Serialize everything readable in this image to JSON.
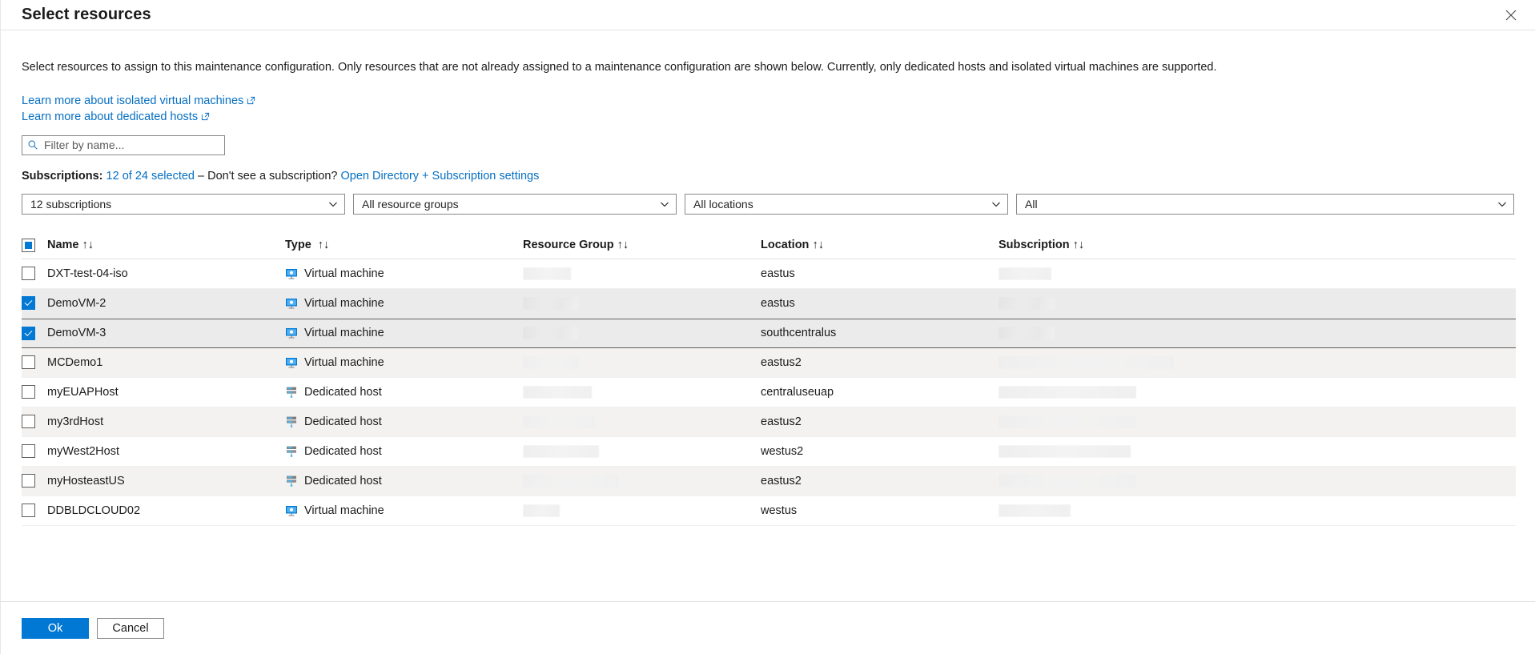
{
  "blade": {
    "title": "Select resources",
    "close_icon": "close-icon",
    "description": "Select resources to assign to this maintenance configuration. Only resources that are not already assigned to a maintenance configuration are shown below. Currently, only dedicated hosts and isolated virtual machines are supported."
  },
  "links": [
    {
      "label": "Learn more about isolated virtual machines",
      "icon": "external-link-icon"
    },
    {
      "label": "Learn more about dedicated hosts",
      "icon": "external-link-icon"
    }
  ],
  "filter": {
    "placeholder": "Filter by name...",
    "value": "",
    "icon": "search-icon"
  },
  "subscriptions_line": {
    "label": "Subscriptions:",
    "selected_link": "12 of 24 selected",
    "separator": "– Don't see a subscription?",
    "settings_link": "Open Directory + Subscription settings"
  },
  "dropdowns": [
    {
      "name": "subscription-filter",
      "value": "12 subscriptions"
    },
    {
      "name": "resource-group-filter",
      "value": "All resource groups"
    },
    {
      "name": "location-filter",
      "value": "All locations"
    },
    {
      "name": "type-filter",
      "value": "All"
    }
  ],
  "table": {
    "header_checkbox_state": "indeterminate",
    "columns": [
      {
        "label": "Name",
        "sort_icon": "sort-arrows-icon"
      },
      {
        "label": "Type",
        "sort_icon": "sort-arrows-icon"
      },
      {
        "label": "Resource Group",
        "sort_icon": "sort-arrows-icon"
      },
      {
        "label": "Location",
        "sort_icon": "sort-arrows-icon"
      },
      {
        "label": "Subscription",
        "sort_icon": "sort-arrows-icon"
      }
    ],
    "rows": [
      {
        "name": "DXT-test-04-iso",
        "type": "Virtual machine",
        "type_icon": "virtual-machine-icon",
        "location": "eastus",
        "checked": false,
        "selected": false,
        "focused": false,
        "rg_width": 60,
        "sub_width": 66
      },
      {
        "name": "DemoVM-2",
        "type": "Virtual machine",
        "type_icon": "virtual-machine-icon",
        "location": "eastus",
        "checked": true,
        "selected": true,
        "focused": false,
        "rg_width": 68,
        "sub_width": 70
      },
      {
        "name": "DemoVM-3",
        "type": "Virtual machine",
        "type_icon": "virtual-machine-icon",
        "location": "southcentralus",
        "checked": true,
        "selected": true,
        "focused": true,
        "rg_width": 68,
        "sub_width": 70
      },
      {
        "name": "MCDemo1",
        "type": "Virtual machine",
        "type_icon": "virtual-machine-icon",
        "location": "eastus2",
        "checked": false,
        "selected": false,
        "focused": false,
        "rg_width": 70,
        "sub_width": 219
      },
      {
        "name": "myEUAPHost",
        "type": "Dedicated host",
        "type_icon": "dedicated-host-icon",
        "location": "centraluseuap",
        "checked": false,
        "selected": false,
        "focused": false,
        "rg_width": 86,
        "sub_width": 172
      },
      {
        "name": "my3rdHost",
        "type": "Dedicated host",
        "type_icon": "dedicated-host-icon",
        "location": "eastus2",
        "checked": false,
        "selected": false,
        "focused": false,
        "rg_width": 90,
        "sub_width": 172
      },
      {
        "name": "myWest2Host",
        "type": "Dedicated host",
        "type_icon": "dedicated-host-icon",
        "location": "westus2",
        "checked": false,
        "selected": false,
        "focused": false,
        "rg_width": 95,
        "sub_width": 165
      },
      {
        "name": "myHosteastUS",
        "type": "Dedicated host",
        "type_icon": "dedicated-host-icon",
        "location": "eastus2",
        "checked": false,
        "selected": false,
        "focused": false,
        "rg_width": 120,
        "sub_width": 172
      },
      {
        "name": "DDBLDCLOUD02",
        "type": "Virtual machine",
        "type_icon": "virtual-machine-icon",
        "location": "westus",
        "checked": false,
        "selected": false,
        "focused": false,
        "rg_width": 46,
        "sub_width": 90
      }
    ]
  },
  "footer": {
    "ok_label": "Ok",
    "cancel_label": "Cancel"
  },
  "colors": {
    "accent": "#0078d4",
    "link": "#056fc3",
    "selected_row": "#ebebeb",
    "zebra_row": "#f3f2f1",
    "text": "#1b1b1b"
  }
}
